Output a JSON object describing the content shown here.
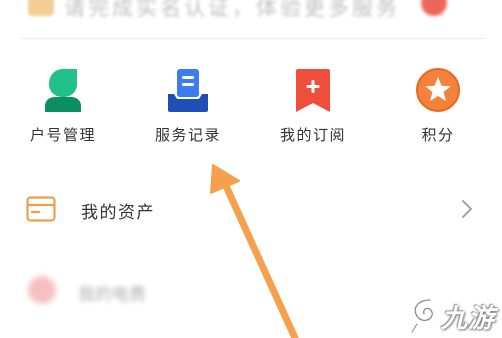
{
  "banner": {
    "text": "请完成实名认证，体验更多服务"
  },
  "grid": {
    "items": [
      {
        "label": "户号管理",
        "icon": "user-account-icon",
        "color": "#22c08a"
      },
      {
        "label": "服务记录",
        "icon": "service-record-icon",
        "color": "#3b7cf0"
      },
      {
        "label": "我的订阅",
        "icon": "subscription-bookmark-icon",
        "color": "#ee4e3a"
      },
      {
        "label": "积分",
        "icon": "points-star-icon",
        "color": "#f5823a"
      }
    ]
  },
  "assets": {
    "label": "我的资产",
    "icon": "wallet-icon",
    "icon_color": "#e9a24a"
  },
  "blurred_row": {
    "text": "我的电费"
  },
  "annotation": {
    "arrow_color": "#f5a04d"
  },
  "watermark": {
    "text": "九游"
  }
}
